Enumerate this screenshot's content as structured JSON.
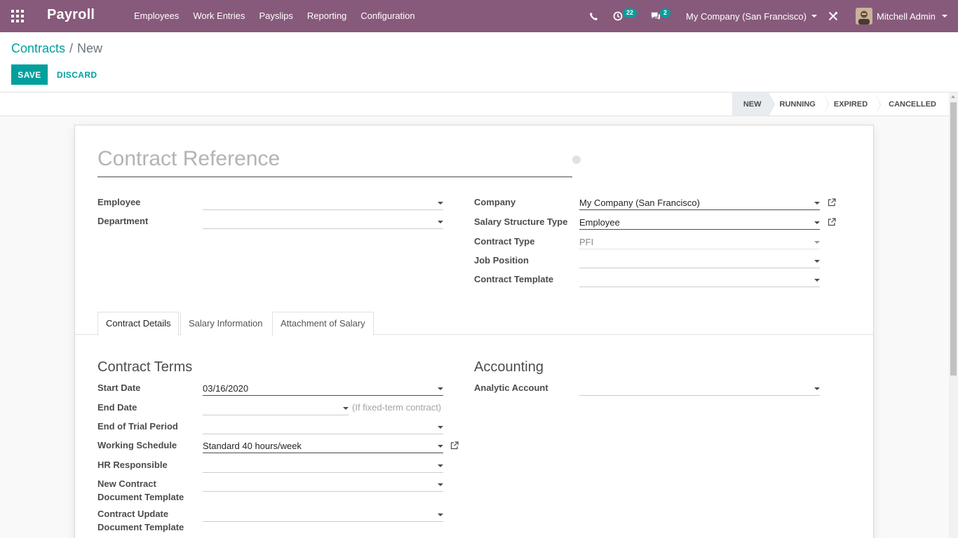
{
  "navbar": {
    "app_name": "Payroll",
    "menu": [
      "Employees",
      "Work Entries",
      "Payslips",
      "Reporting",
      "Configuration"
    ],
    "activity_count": "22",
    "message_count": "2",
    "company": "My Company (San Francisco)",
    "user": "Mitchell Admin"
  },
  "breadcrumb": {
    "parent": "Contracts",
    "separator": "/",
    "current": "New"
  },
  "buttons": {
    "save": "SAVE",
    "discard": "DISCARD"
  },
  "statusbar": {
    "stages": [
      "NEW",
      "RUNNING",
      "EXPIRED",
      "CANCELLED"
    ],
    "active": "NEW"
  },
  "form": {
    "title_placeholder": "Contract Reference",
    "left": {
      "employee_label": "Employee",
      "employee_value": "",
      "department_label": "Department",
      "department_value": ""
    },
    "right": {
      "company_label": "Company",
      "company_value": "My Company (San Francisco)",
      "structure_label": "Salary Structure Type",
      "structure_value": "Employee",
      "contract_type_label": "Contract Type",
      "contract_type_value": "PFI",
      "job_label": "Job Position",
      "job_value": "",
      "template_label": "Contract Template",
      "template_value": ""
    },
    "tabs": [
      "Contract Details",
      "Salary Information",
      "Attachment of Salary"
    ],
    "contract_terms": {
      "heading": "Contract Terms",
      "start_label": "Start Date",
      "start_value": "03/16/2020",
      "end_label": "End Date",
      "end_value": "",
      "end_hint": "(If fixed-term contract)",
      "trial_label": "End of Trial Period",
      "trial_value": "",
      "schedule_label": "Working Schedule",
      "schedule_value": "Standard 40 hours/week",
      "hr_label": "HR Responsible",
      "hr_value": "",
      "new_doc_label_1": "New Contract",
      "new_doc_label_2": "Document Template",
      "new_doc_value": "",
      "upd_doc_label_1": "Contract Update",
      "upd_doc_label_2": "Document Template",
      "upd_doc_value": ""
    },
    "accounting": {
      "heading": "Accounting",
      "analytic_label": "Analytic Account",
      "analytic_value": ""
    }
  },
  "colors": {
    "brand": "#875a7b",
    "accent": "#00a09d"
  },
  "icons": [
    "apps-grid-icon",
    "phone-icon",
    "activity-clock-icon",
    "chat-icon",
    "debug-icon",
    "external-link-icon"
  ]
}
